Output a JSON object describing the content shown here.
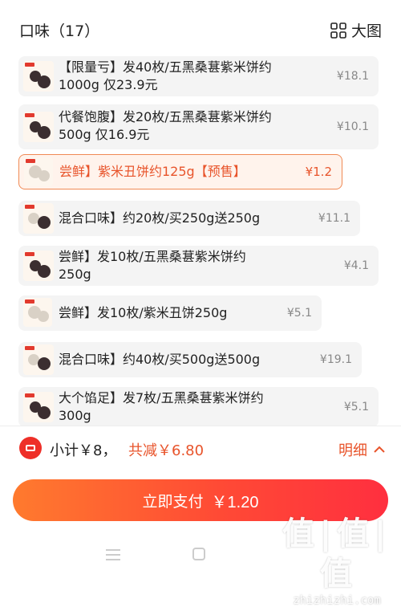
{
  "header": {
    "title": "口味（17）",
    "view_toggle_label": "大图"
  },
  "items": [
    {
      "name_line1": "【限量亏】发40枚/五黑桑葚紫米饼约",
      "name_line2": "1000g 仅23.9元",
      "price": "¥18.1",
      "selected": false
    },
    {
      "name_line1": "代餐饱腹】发20枚/五黑桑葚紫米饼约",
      "name_line2": "500g 仅16.9元",
      "price": "¥10.1",
      "selected": false
    },
    {
      "name_line1": "尝鲜】紫米丑饼约125g【预售】",
      "name_line2": "",
      "price": "¥1.2",
      "selected": true
    },
    {
      "name_line1": "混合口味】约20枚/买250g送250g",
      "name_line2": "",
      "price": "¥11.1",
      "selected": false
    },
    {
      "name_line1": "尝鲜】发10枚/五黑桑葚紫米饼约",
      "name_line2": "250g",
      "price": "¥4.1",
      "selected": false
    },
    {
      "name_line1": "尝鲜】发10枚/紫米丑饼250g",
      "name_line2": "",
      "price": "¥5.1",
      "selected": false
    },
    {
      "name_line1": "混合口味】约40枚/买500g送500g",
      "name_line2": "",
      "price": "¥19.1",
      "selected": false
    },
    {
      "name_line1": "大个馅足】发7枚/五黑桑葚紫米饼约",
      "name_line2": "300g",
      "price": "¥5.1",
      "selected": false
    }
  ],
  "summary": {
    "subtotal": "小计￥8，",
    "discount": "共减￥6.80",
    "details_label": "明细"
  },
  "pay": {
    "label": "立即支付",
    "amount": "￥1.20"
  },
  "watermark": {
    "logo": "值|值|值",
    "site": "zhizhizhi.com"
  },
  "colors": {
    "accent": "#e8542b",
    "pay_gradient_start": "#ff7a2e",
    "pay_gradient_end": "#ff2f3f",
    "selected_bg": "#fff3ec"
  }
}
